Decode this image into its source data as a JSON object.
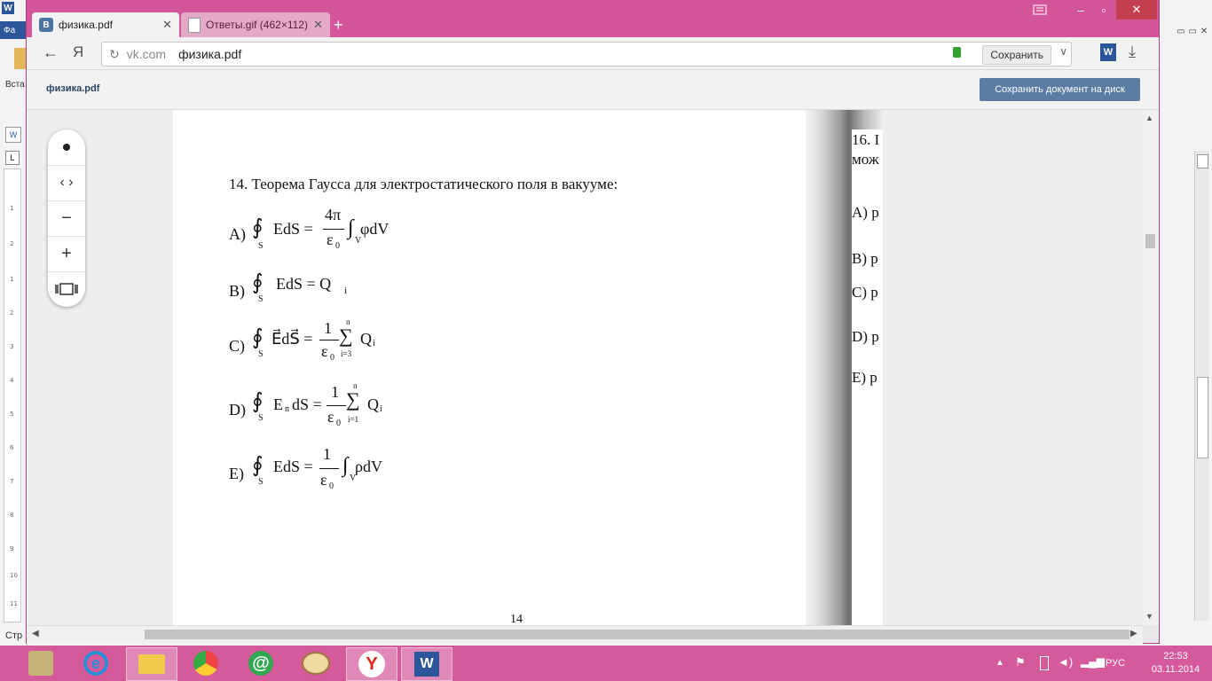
{
  "word_bg": {
    "tab_fragment": "Фа",
    "insert_fragment": "Вста",
    "status_fragment": "Стр",
    "ruler_ticks": [
      "1",
      "2",
      "1",
      "2",
      "3",
      "4",
      "5",
      "6",
      "7",
      "8",
      "9",
      "10",
      "11"
    ]
  },
  "browser": {
    "tabs": [
      {
        "label": "физика.pdf",
        "icon": "vk-icon",
        "active": true
      },
      {
        "label": "Ответы.gif (462×112)",
        "icon": "document-icon",
        "active": false
      }
    ],
    "address": {
      "domain": "vk.com",
      "path": "физика.pdf"
    },
    "save_label": "Сохранить",
    "pdf_title": "физика.pdf",
    "save_disk_label": "Сохранить документ на диск"
  },
  "document": {
    "question_14": "14. Теорема Гаусса для электростатического поля в вакууме:",
    "options": [
      {
        "letter": "A)",
        "lhs": "EdS =",
        "num": "4π",
        "den": "ε",
        "den_sub": "0",
        "tail": "φdV",
        "oint_sub": "S",
        "int_sub": "V"
      },
      {
        "letter": "B)",
        "lhs": "EdS = Q",
        "lhs_sub": "i",
        "oint_sub": "S"
      },
      {
        "letter": "C)",
        "lhs": "E⃗dS⃗ =",
        "num": "1",
        "den": "ε",
        "den_sub": "0",
        "sum_top": "n",
        "sum_bot": "i=3",
        "tail": "Q",
        "tail_sub": "i",
        "oint_sub": "S"
      },
      {
        "letter": "D)",
        "lhs_a": "E",
        "lhs_sub": "n",
        "lhs_b": "dS =",
        "num": "1",
        "den": "ε",
        "den_sub": "0",
        "sum_top": "n",
        "sum_bot": "i=1",
        "tail": "Q",
        "tail_sub": "i",
        "oint_sub": "S"
      },
      {
        "letter": "E)",
        "lhs": "EdS =",
        "num": "1",
        "den": "ε",
        "den_sub": "0",
        "tail": "ρdV",
        "oint_sub": "S",
        "int_sub": "V"
      }
    ],
    "page_number": "14",
    "right_page": {
      "line1": "16. I",
      "line2": "мож",
      "answers": [
        "A) p",
        "B) p",
        "C) p",
        "D) p",
        "E) p"
      ]
    }
  },
  "taskbar": {
    "lang": "РУС",
    "time": "22:53",
    "date": "03.11.2014"
  },
  "colors": {
    "accent": "#d4569a",
    "vk": "#4c75a3",
    "save_button": "#5b7ca3"
  }
}
